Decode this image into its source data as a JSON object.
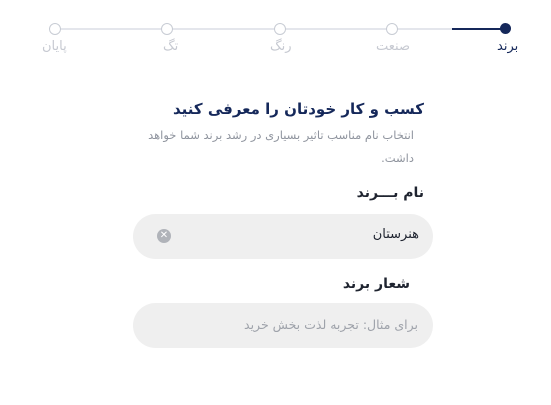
{
  "stepper": {
    "steps": [
      {
        "label": "برند",
        "active": true
      },
      {
        "label": "صنعت",
        "active": false
      },
      {
        "label": "رنگ",
        "active": false
      },
      {
        "label": "تگ",
        "active": false
      },
      {
        "label": "پایان",
        "active": false
      }
    ]
  },
  "heading": {
    "title": "کسب و کار خودتان را معرفی کنید",
    "description": "انتخاب نام مناسب تاثیر بسیاری در رشد برند شما خواهد داشت."
  },
  "brand_name": {
    "label": "نام بـــرند",
    "value": "هنرستان",
    "clear_icon": "close-circle-icon"
  },
  "slogan": {
    "label": "شعار برند",
    "placeholder": "برای مثال: تجربه لذت بخش خرید",
    "value": ""
  },
  "colors": {
    "accent": "#15285a",
    "inactive": "#c6c9d1",
    "input_bg": "#efefef"
  }
}
